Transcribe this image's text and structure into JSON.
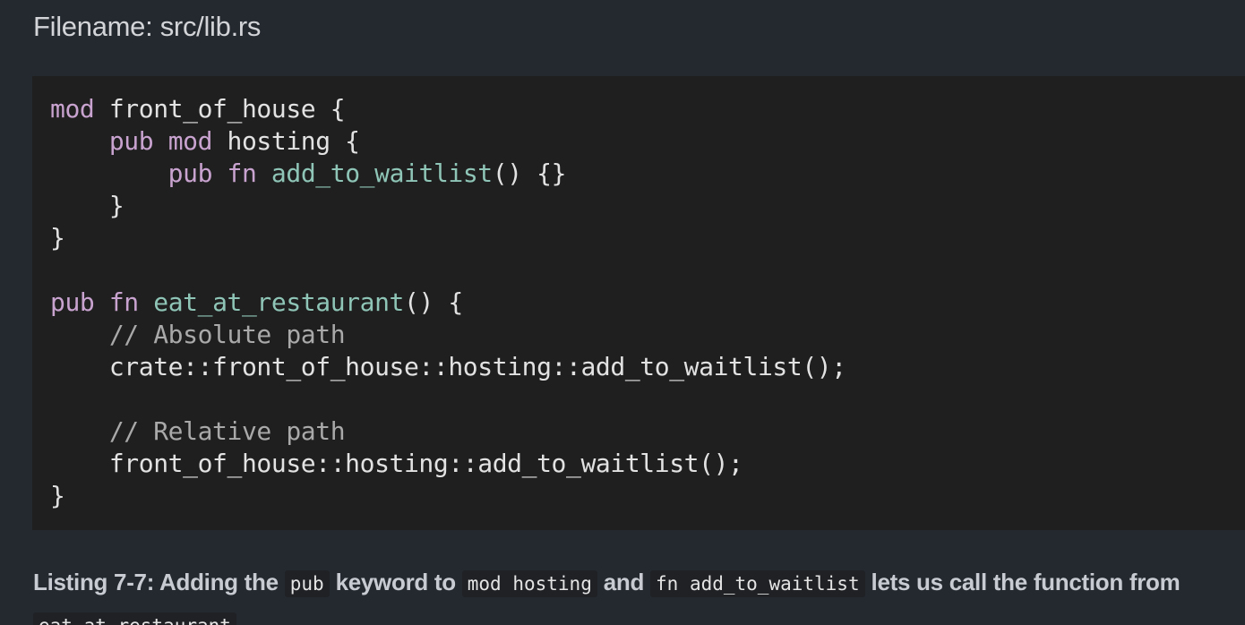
{
  "filename": "Filename: src/lib.rs",
  "code": {
    "l1": {
      "t1": "mod",
      "t2": " front_of_house {"
    },
    "l2": {
      "t0": "    ",
      "t1": "pub",
      "t2": " ",
      "t3": "mod",
      "t4": " hosting {"
    },
    "l3": {
      "t0": "        ",
      "t1": "pub",
      "t2": " ",
      "t3": "fn",
      "t4": " ",
      "t5": "add_to_waitlist",
      "t6": "() {}"
    },
    "l4": {
      "t0": "    }"
    },
    "l5": {
      "t0": "}"
    },
    "l6": {
      "t0": ""
    },
    "l7": {
      "t1": "pub",
      "t2": " ",
      "t3": "fn",
      "t4": " ",
      "t5": "eat_at_restaurant",
      "t6": "() {"
    },
    "l8": {
      "t0": "    ",
      "t1": "// Absolute path"
    },
    "l9": {
      "t0": "    crate::front_of_house::hosting::add_to_waitlist();"
    },
    "l10": {
      "t0": ""
    },
    "l11": {
      "t0": "    ",
      "t1": "// Relative path"
    },
    "l12": {
      "t0": "    front_of_house::hosting::add_to_waitlist();"
    },
    "l13": {
      "t0": "}"
    }
  },
  "caption": {
    "prefix": "Listing 7-7: Adding the ",
    "code1": "pub",
    "mid1": " keyword to ",
    "code2": "mod hosting",
    "mid2": " and ",
    "code3": "fn add_to_waitlist",
    "suffix": " lets us call the function from",
    "code4": "eat_at_restaurant"
  },
  "colors": {
    "background": "#242930",
    "code_background": "#1f1f1f",
    "keyword": "#c9a3d0",
    "function_name": "#8ec5b6",
    "comment": "#a9a9a9"
  }
}
